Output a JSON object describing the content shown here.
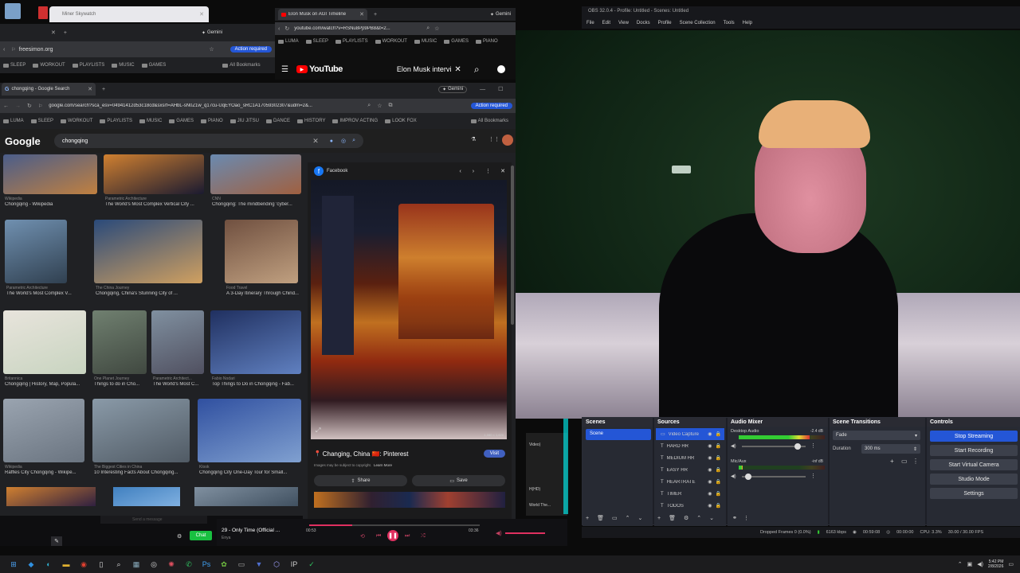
{
  "desktop": {
    "bg": "#0c0c0c"
  },
  "window_top_left": {
    "tab_title": "Miner Skywatch",
    "address": "freesimon.org",
    "gemini_label": "Gemini",
    "action_required": "Action required",
    "bookmarks": [
      "SLEEP",
      "WORKOUT",
      "PLAYLISTS",
      "MUSIC",
      "GAMES"
    ],
    "all_bookmarks": "All Bookmarks"
  },
  "window_youtube": {
    "tab_title": "Elon Musk on AGI Timeline",
    "address": "youtube.com/watch?v=RSNu8Pp9PB8&t=2...",
    "gemini_label": "Gemini",
    "bookmarks": [
      "LUMA",
      "SLEEP",
      "PLAYLISTS",
      "WORKOUT",
      "MUSIC",
      "GAMES",
      "PIANO"
    ],
    "logo": "YouTube",
    "search_value": "Elon Musk intervi"
  },
  "window_google": {
    "tab_title": "chongqing - Google Search",
    "gemini_label": "Gemini",
    "address": "google.com/search?sca_esv=04941412d53c18cd&sxsrf=AHbL-sN0Z1w_q17cu-UqEYOao_sRC1A17059302307&udm=2&...",
    "action_required": "Action required",
    "bookmarks": [
      "LUMA",
      "SLEEP",
      "WORKOUT",
      "PLAYLISTS",
      "MUSIC",
      "GAMES",
      "PIANO",
      "JIU JITSU",
      "DANCE",
      "HISTORY",
      "IMPROV ACTING",
      "LOOK FOX"
    ],
    "all_bookmarks": "All Bookmarks",
    "logo": "Google",
    "search_value": "chongqing"
  },
  "images": [
    {
      "src": "Wikipedia",
      "cap": "Chongqing - Wikipedia",
      "c1": "#4a5d8a",
      "c2": "#c08040"
    },
    {
      "src": "Parametric Architecture",
      "cap": "The World's Most Complex Vertical City ...",
      "c1": "#d08030",
      "c2": "#1a1a30"
    },
    {
      "src": "CNN",
      "cap": "Chongqing: The mindbending 'cyber...",
      "c1": "#6a8ab0",
      "c2": "#a06040"
    },
    {
      "src": "Parametric Architecture",
      "cap": "The World's Most Complex V...",
      "c1": "#7090b0",
      "c2": "#304050"
    },
    {
      "src": "The China Journey",
      "cap": "Chongqing, China's Stunning City of ...",
      "c1": "#2a4a7a",
      "c2": "#d0a060"
    },
    {
      "src": "Food Travel",
      "cap": "A 3-Day Itinerary Through Chind...",
      "c1": "#705040",
      "c2": "#c0a080"
    },
    {
      "src": "Britannica",
      "cap": "Chongqing | History, Map, Popula...",
      "c1": "#e8e4dc",
      "c2": "#c8d4c0"
    },
    {
      "src": "One Planet Journey",
      "cap": "Things to do in Cho...",
      "c1": "#708070",
      "c2": "#404840"
    },
    {
      "src": "Parametric Architect...",
      "cap": "The World's Most C...",
      "c1": "#8090a0",
      "c2": "#505060"
    },
    {
      "src": "Fabio Nodari",
      "cap": "Top Things to Do in Chongqing - Fab...",
      "c1": "#203060",
      "c2": "#6080c0"
    },
    {
      "src": "Wikipedia",
      "cap": "Raffles City Chongqing - Wikipe...",
      "c1": "#9aa4b0",
      "c2": "#6a7480"
    },
    {
      "src": "The Biggest Cities in China",
      "cap": "10 Interesting Facts About Chongqing...",
      "c1": "#8a9aa8",
      "c2": "#505a64"
    },
    {
      "src": "Klook",
      "cap": "Chongqing City One-Day Tour for Small...",
      "c1": "#3050a0",
      "c2": "#80a0d0"
    }
  ],
  "preview": {
    "source": "Facebook",
    "title": "Changing, China 🇨🇳: Pinterest",
    "disclaimer": "Images may be subject to copyright.",
    "learn_more": "Learn More",
    "visit": "Visit",
    "share": "Share",
    "save": "Save",
    "dims": "1,080 × 1,620"
  },
  "chat_strip": {
    "placeholder": "Send a message",
    "chat_button": "Chat",
    "side_items": [
      "Video)",
      "H(HD)",
      "World The..."
    ]
  },
  "music_player": {
    "track": "29 - Only Time (Official ...",
    "artist": "Enya",
    "elapsed": "00:53",
    "duration": "03:36",
    "progress": 0.25
  },
  "obs": {
    "title": "OBS 32.0.4 - Profile: Untitled - Scenes: Untitled",
    "menu": [
      "File",
      "Edit",
      "View",
      "Docks",
      "Profile",
      "Scene Collection",
      "Tools",
      "Help"
    ],
    "scenes_title": "Scenes",
    "scenes": [
      "Scene"
    ],
    "sources_title": "Sources",
    "sources": [
      "Video Capture",
      "HARD HR",
      "MEDIUM HR",
      "EASY HR",
      "HEARTRATE",
      "TIMER",
      "TODOS"
    ],
    "mixer_title": "Audio Mixer",
    "mixer_channels": [
      {
        "name": "Desktop Audio",
        "db": "-2.4 dB",
        "level": 0.82
      },
      {
        "name": "Mic/Aux",
        "db": "-inf dB",
        "level": 0.05
      }
    ],
    "transitions_title": "Scene Transitions",
    "transition_value": "Fade",
    "duration_label": "Duration",
    "duration_value": "300 ms",
    "controls_title": "Controls",
    "controls": [
      "Stop Streaming",
      "Start Recording",
      "Start Virtual Camera",
      "Studio Mode",
      "Settings"
    ],
    "status": {
      "dropped": "Dropped Frames 0 (0.0%)",
      "kbps": "6163 kbps",
      "live": "00:59:08",
      "rec": "00:00:00",
      "cpu": "CPU: 3.3%",
      "fps": "30.00 / 30.00 FPS"
    }
  },
  "taskbar": {
    "time": "5:42 PM",
    "date": "2/8/2026"
  },
  "colors": {
    "obs_accent": "#2456d6",
    "google_accent": "#8ab4f8",
    "preview_visit": "#4060c0"
  }
}
